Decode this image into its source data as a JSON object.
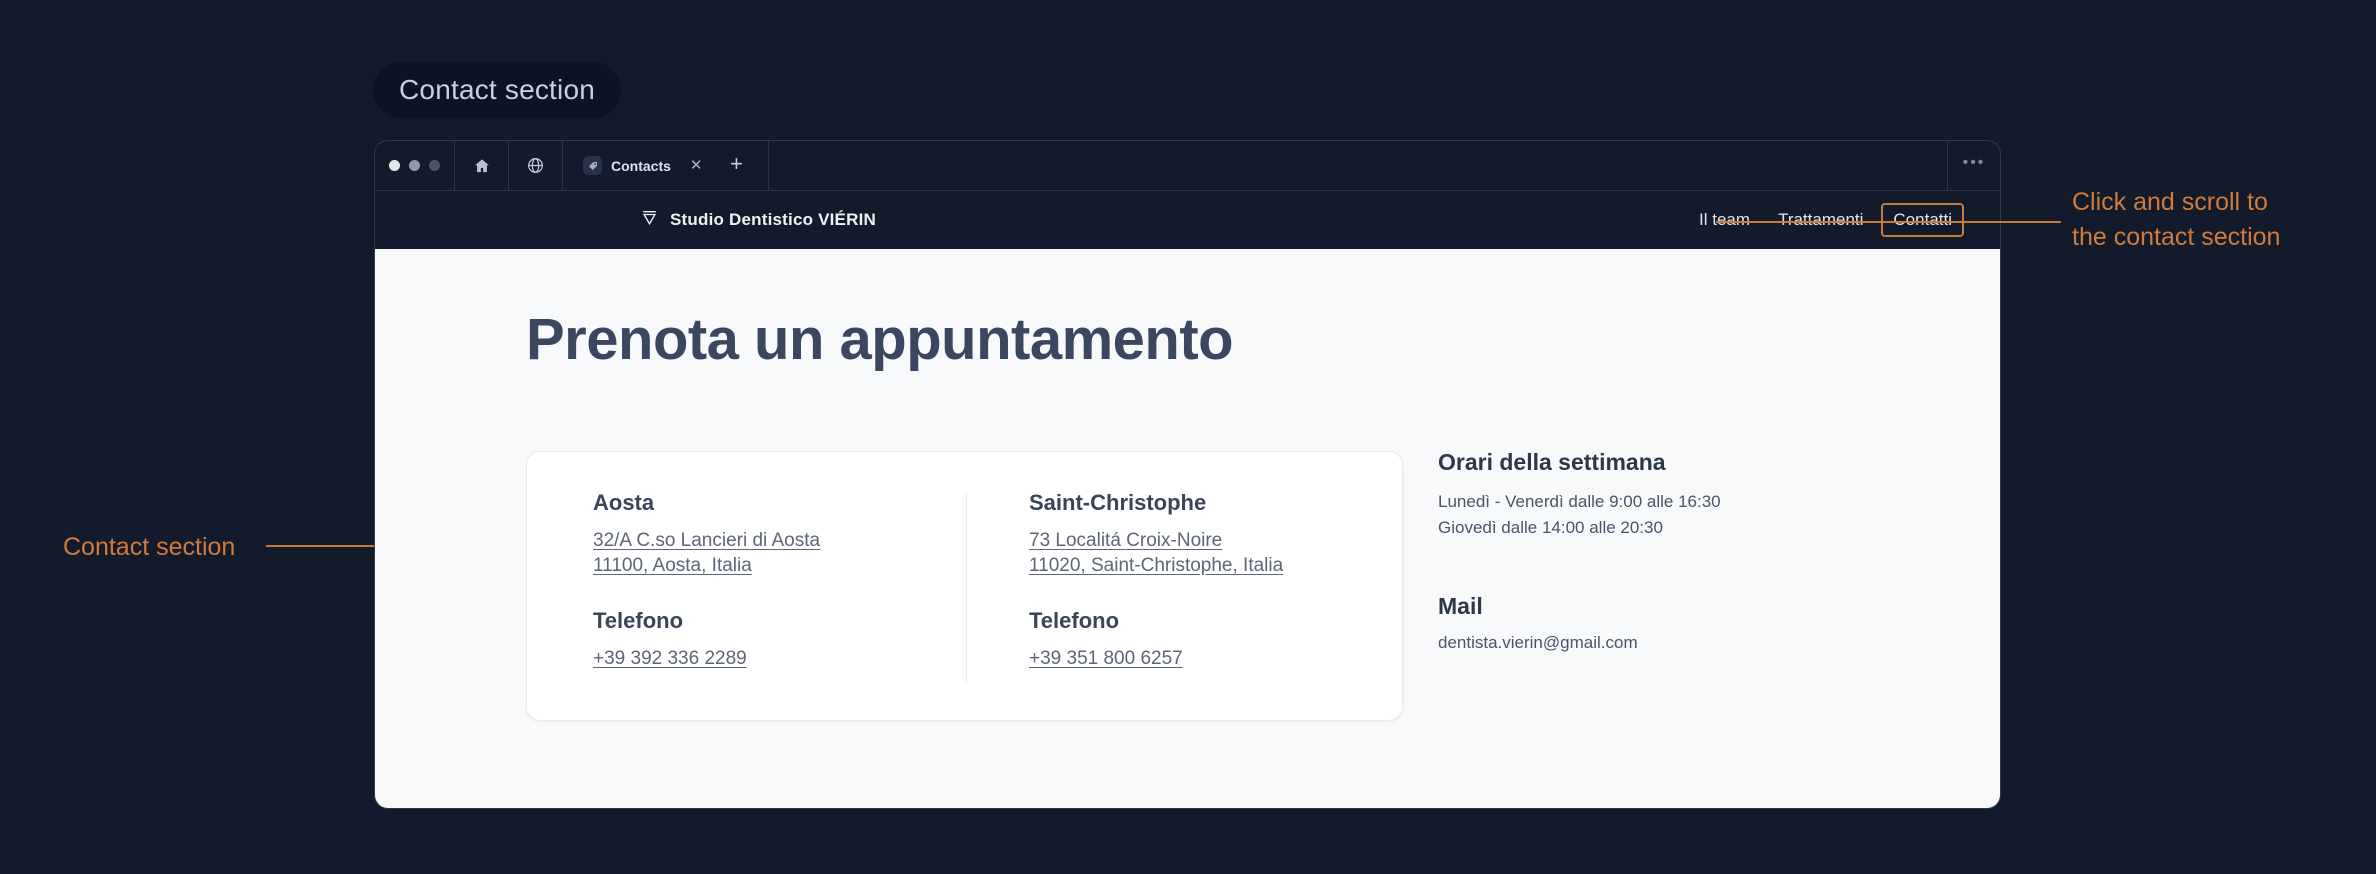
{
  "annotations": {
    "section_pill": "Contact section",
    "left_label": "Contact section",
    "right_label_line1": "Click and scroll to",
    "right_label_line2": "the contact section",
    "accent_color": "#c97b3e"
  },
  "browser": {
    "window_dots": [
      "white",
      "gray",
      "dark"
    ],
    "home_icon": "home-icon",
    "globe_icon": "globe-icon",
    "tab": {
      "favicon": "site-favicon",
      "title": "Contacts",
      "close": "✕"
    },
    "new_tab": "+",
    "more_menu": "•••"
  },
  "site": {
    "brand": "Studio Dentistico VIÉRIN",
    "brand_logo_icon": "funnel-logo-icon",
    "nav": [
      {
        "label": "Il team",
        "active": false
      },
      {
        "label": "Trattamenti",
        "active": false
      },
      {
        "label": "Contatti",
        "active": true
      }
    ]
  },
  "main": {
    "heading": "Prenota un appuntamento",
    "locations": [
      {
        "name": "Aosta",
        "address_line1": "32/A  C.so Lancieri di Aosta",
        "address_line2": "11100, Aosta, Italia",
        "phone_label": "Telefono",
        "phone": "+39 392 336 2289"
      },
      {
        "name": "Saint-Christophe",
        "address_line1": "73  Localitá Croix-Noire",
        "address_line2": "11020, Saint-Christophe, Italia",
        "phone_label": "Telefono",
        "phone": "+39 351 800 6257"
      }
    ],
    "hours": {
      "title": "Orari della settimana",
      "line1": "Lunedì - Venerdì dalle 9:00 alle 16:30",
      "line2": "Giovedì dalle 14:00 alle 20:30"
    },
    "mail": {
      "title": "Mail",
      "value": "dentista.vierin@gmail.com"
    }
  },
  "colors": {
    "page_bg": "#f8f9fb",
    "chrome_bg": "#131a2b",
    "heading": "#3b4760",
    "accent": "#c97b3e"
  }
}
